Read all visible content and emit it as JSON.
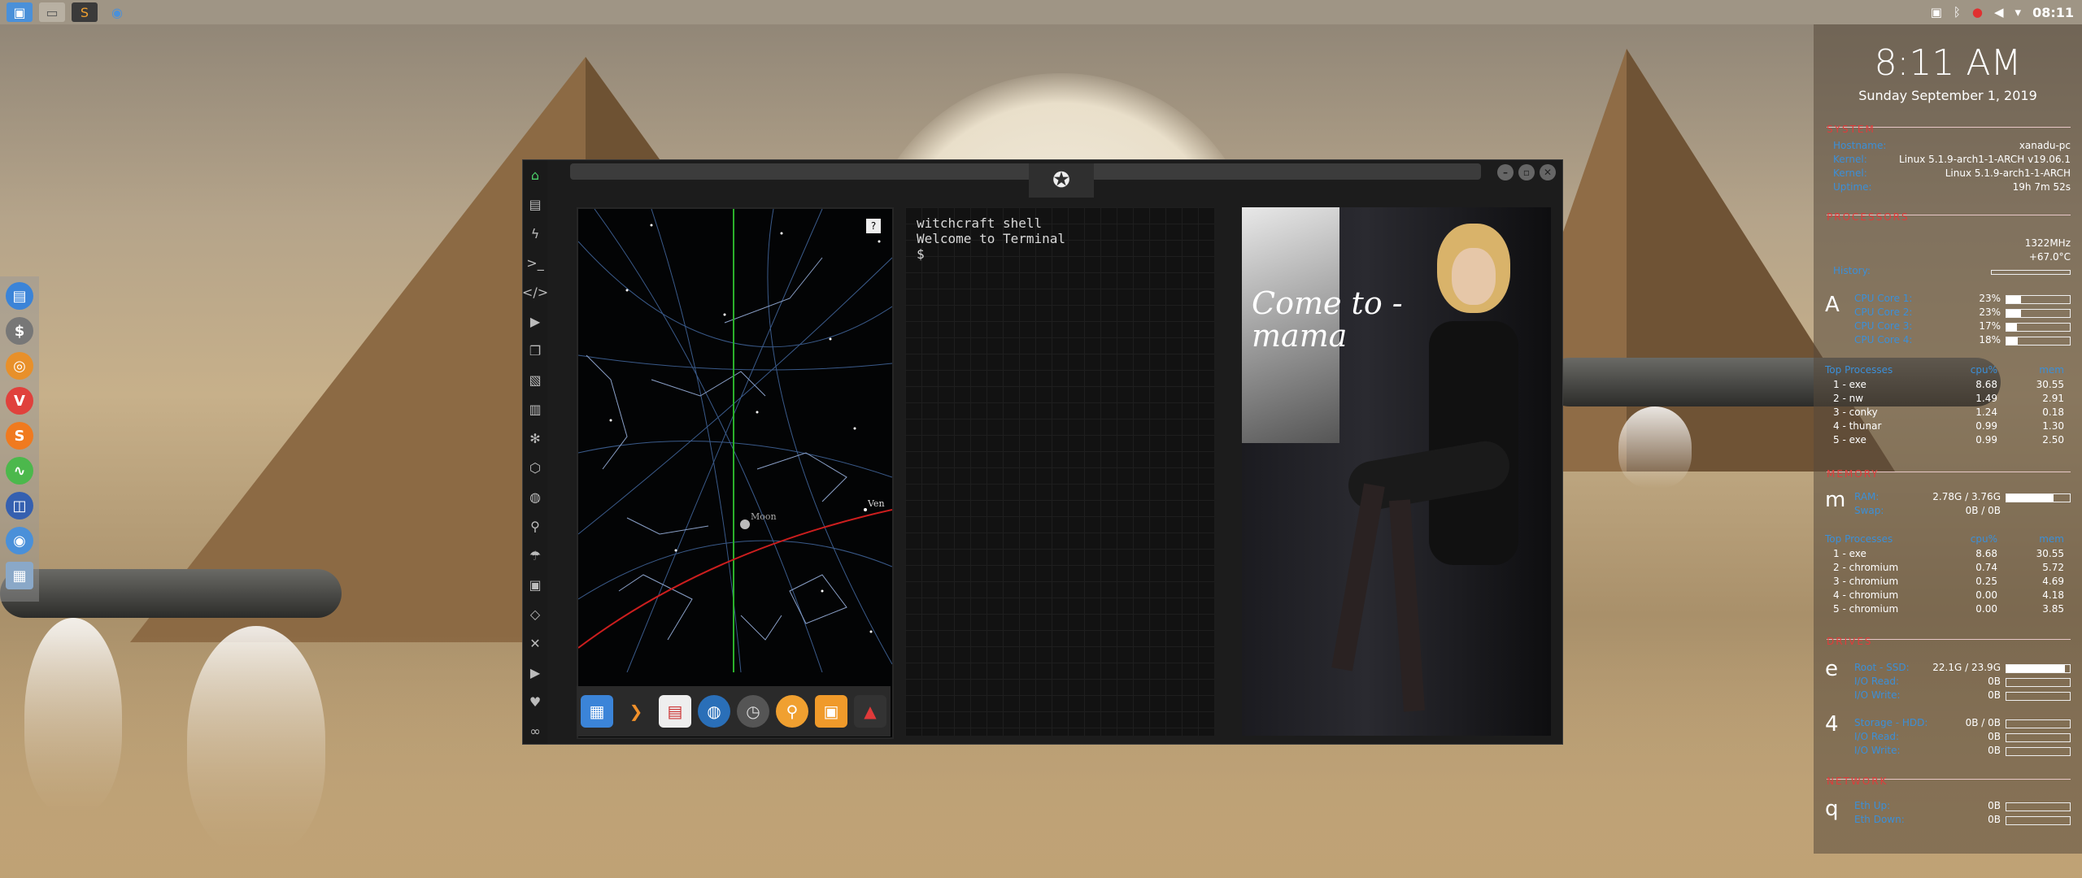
{
  "topbar": {
    "clock": "08:11",
    "apps": [
      "file-manager-icon",
      "window-icon",
      "sublime-icon",
      "chromium-icon"
    ],
    "tray": [
      "photo-tray-icon",
      "bluetooth-icon",
      "record-icon",
      "volume-icon",
      "wifi-icon"
    ]
  },
  "dock": {
    "items": [
      "files",
      "money",
      "dial",
      "vivaldi",
      "s-app",
      "activity",
      "screen",
      "chromium",
      "grid"
    ]
  },
  "window": {
    "iconbar": [
      "home-icon",
      "document-icon",
      "lightning-icon",
      "terminal-icon",
      "code-icon",
      "play-icon",
      "copy-icon",
      "image-icon",
      "news-icon",
      "settings-icon",
      "hex-icon",
      "globe-icon",
      "search-icon",
      "umbrella-icon",
      "contact-icon",
      "tag-icon",
      "expand-icon",
      "youtube-icon",
      "heart-icon",
      "bike-icon"
    ],
    "starmap": {
      "help": "?",
      "moon_label": "Moon",
      "venus_label": "Ven"
    },
    "terminal": {
      "line1": "witchcraft shell",
      "line2": "Welcome to Terminal",
      "line3": "$"
    },
    "photo_caption": "Come to - mama",
    "appbar": [
      "calculator",
      "arrow",
      "calendar",
      "globe",
      "clock",
      "magnifier",
      "image-viewer",
      "red-app"
    ]
  },
  "conky": {
    "time": "8:11 AM",
    "date": "Sunday September 1, 2019",
    "system": {
      "title": "SYSTEM",
      "rows": [
        {
          "k": "Hostname:",
          "v": "xanadu-pc"
        },
        {
          "k": "Kernel:",
          "v": "Linux 5.1.9-arch1-1-ARCH v19.06.1"
        },
        {
          "k": "Kernel:",
          "v": "Linux 5.1.9-arch1-1-ARCH"
        },
        {
          "k": "Uptime:",
          "v": "19h 7m 52s"
        }
      ]
    },
    "processors": {
      "title": "PROCESSORS",
      "freq": "1322MHz",
      "temp": "+67.0°C",
      "history_label": "History:",
      "letter": "A",
      "cores": [
        {
          "k": "CPU Core 1:",
          "v": "23%",
          "p": 0.23
        },
        {
          "k": "CPU Core 2:",
          "v": "23%",
          "p": 0.23
        },
        {
          "k": "CPU Core 3:",
          "v": "17%",
          "p": 0.17
        },
        {
          "k": "CPU Core 4:",
          "v": "18%",
          "p": 0.18
        }
      ],
      "top_title": "Top Processes",
      "col_cpu": "cpu%",
      "col_mem": "mem",
      "procs": [
        {
          "n": "1 - exe",
          "c": "8.68",
          "m": "30.55"
        },
        {
          "n": "2 - nw",
          "c": "1.49",
          "m": "2.91"
        },
        {
          "n": "3 - conky",
          "c": "1.24",
          "m": "0.18"
        },
        {
          "n": "4 - thunar",
          "c": "0.99",
          "m": "1.30"
        },
        {
          "n": "5 - exe",
          "c": "0.99",
          "m": "2.50"
        }
      ]
    },
    "memory": {
      "title": "MEMORY",
      "letter": "m",
      "ram_k": "RAM:",
      "ram_v": "2.78G / 3.76G",
      "ram_p": 0.74,
      "swap_k": "Swap:",
      "swap_v": "0B / 0B",
      "top_title": "Top Processes",
      "col_cpu": "cpu%",
      "col_mem": "mem",
      "procs": [
        {
          "n": "1 - exe",
          "c": "8.68",
          "m": "30.55"
        },
        {
          "n": "2 - chromium",
          "c": "0.74",
          "m": "5.72"
        },
        {
          "n": "3 - chromium",
          "c": "0.25",
          "m": "4.69"
        },
        {
          "n": "4 - chromium",
          "c": "0.00",
          "m": "4.18"
        },
        {
          "n": "5 - chromium",
          "c": "0.00",
          "m": "3.85"
        }
      ]
    },
    "drives": {
      "title": "DRIVES",
      "letter1": "e",
      "root_k": "Root - SSD:",
      "root_v": "22.1G / 23.9G",
      "root_p": 0.92,
      "io_read_k": "I/O Read:",
      "io_read_v": "0B",
      "io_write_k": "I/O Write:",
      "io_write_v": "0B",
      "letter2": "4",
      "storage_k": "Storage - HDD:",
      "storage_v": "0B / 0B",
      "io_read2_v": "0B",
      "io_write2_v": "0B"
    },
    "network": {
      "title": "NETWORK",
      "letter": "q",
      "up_k": "Eth Up:",
      "up_v": "0B",
      "down_k": "Eth Down:",
      "down_v": "0B"
    }
  }
}
